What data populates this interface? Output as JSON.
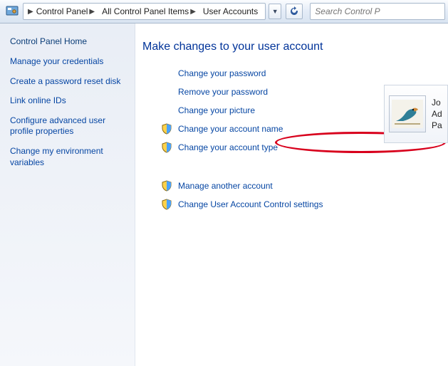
{
  "toolbar": {
    "breadcrumb": [
      "Control Panel",
      "All Control Panel Items",
      "User Accounts"
    ],
    "search_placeholder": "Search Control P"
  },
  "sidebar": {
    "home": "Control Panel Home",
    "links": [
      "Manage your credentials",
      "Create a password reset disk",
      "Link online IDs",
      "Configure advanced user profile properties",
      "Change my environment variables"
    ]
  },
  "main": {
    "heading": "Make changes to your user account",
    "group1": [
      {
        "label": "Change your password",
        "shield": false
      },
      {
        "label": "Remove your password",
        "shield": false
      },
      {
        "label": "Change your picture",
        "shield": false
      },
      {
        "label": "Change your account name",
        "shield": true
      },
      {
        "label": "Change your account type",
        "shield": true
      }
    ],
    "group2": [
      {
        "label": "Manage another account",
        "shield": true
      },
      {
        "label": "Change User Account Control settings",
        "shield": true
      }
    ]
  },
  "user": {
    "line1": "Jo",
    "line2": "Ad",
    "line3": "Pa"
  }
}
